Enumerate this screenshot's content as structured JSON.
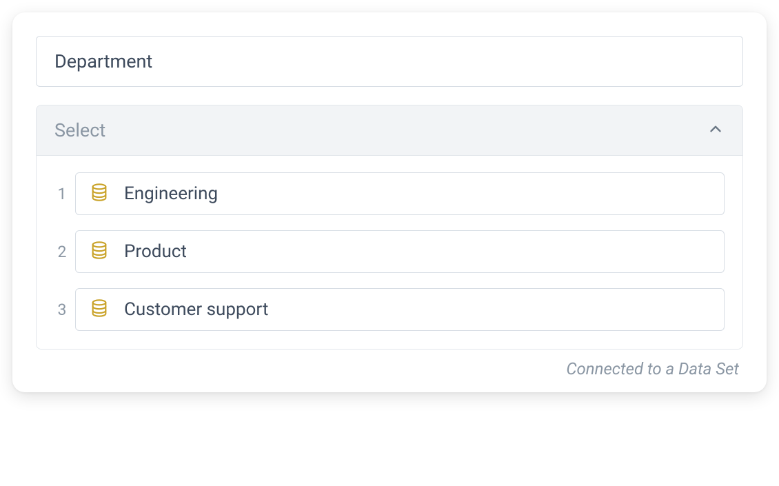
{
  "field": {
    "label": "Department"
  },
  "dropdown": {
    "placeholder": "Select",
    "options": [
      {
        "index": "1",
        "label": "Engineering"
      },
      {
        "index": "2",
        "label": "Product"
      },
      {
        "index": "3",
        "label": "Customer support"
      }
    ]
  },
  "footer": {
    "note": "Connected to a Data Set"
  }
}
